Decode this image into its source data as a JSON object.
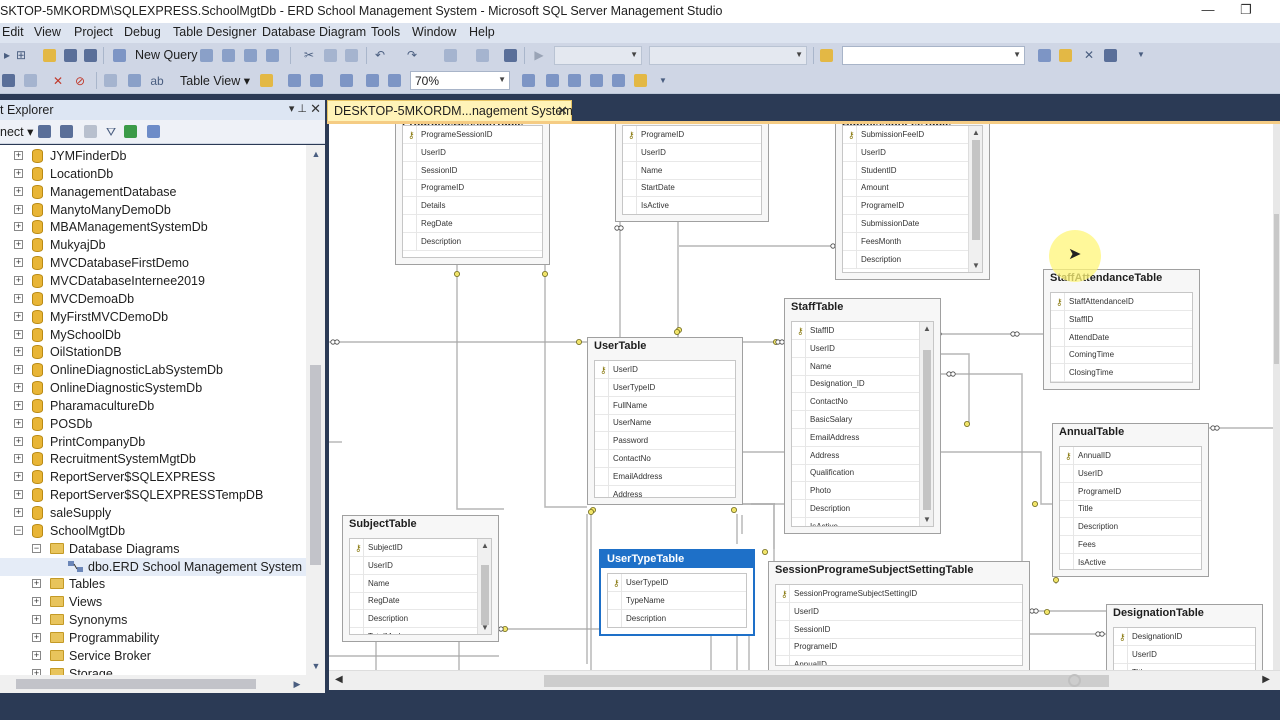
{
  "window": {
    "title": "SKTOP-5MKORDM\\SQLEXPRESS.SchoolMgtDb - ERD School Management System - Microsoft SQL Server Management Studio",
    "minimize": "—",
    "restore": "❐"
  },
  "menu": [
    "Edit",
    "View",
    "Project",
    "Debug",
    "Table Designer",
    "Database Diagram",
    "Tools",
    "Window",
    "Help"
  ],
  "toolbar": {
    "new_query": "New Query",
    "table_view": "Table View",
    "zoom": "70%"
  },
  "explorer": {
    "title": "t Explorer",
    "connect": "nect",
    "nodes": [
      {
        "label": "JYMFinderDb",
        "level": 1,
        "icon": "db",
        "expander": "+"
      },
      {
        "label": "LocationDb",
        "level": 1,
        "icon": "db",
        "expander": "+"
      },
      {
        "label": "ManagementDatabase",
        "level": 1,
        "icon": "db",
        "expander": "+"
      },
      {
        "label": "ManytoManyDemoDb",
        "level": 1,
        "icon": "db",
        "expander": "+"
      },
      {
        "label": "MBAManagementSystemDb",
        "level": 1,
        "icon": "db",
        "expander": "+"
      },
      {
        "label": "MukyajDb",
        "level": 1,
        "icon": "db",
        "expander": "+"
      },
      {
        "label": "MVCDatabaseFirstDemo",
        "level": 1,
        "icon": "db",
        "expander": "+"
      },
      {
        "label": "MVCDatabaseInternee2019",
        "level": 1,
        "icon": "db",
        "expander": "+"
      },
      {
        "label": "MVCDemoaDb",
        "level": 1,
        "icon": "db",
        "expander": "+"
      },
      {
        "label": "MyFirstMVCDemoDb",
        "level": 1,
        "icon": "db",
        "expander": "+"
      },
      {
        "label": "MySchoolDb",
        "level": 1,
        "icon": "db",
        "expander": "+"
      },
      {
        "label": "OilStationDB",
        "level": 1,
        "icon": "db",
        "expander": "+"
      },
      {
        "label": "OnlineDiagnosticLabSystemDb",
        "level": 1,
        "icon": "db",
        "expander": "+"
      },
      {
        "label": "OnlineDiagnosticSystemDb",
        "level": 1,
        "icon": "db",
        "expander": "+"
      },
      {
        "label": "PharamacultureDb",
        "level": 1,
        "icon": "db",
        "expander": "+"
      },
      {
        "label": "POSDb",
        "level": 1,
        "icon": "db",
        "expander": "+"
      },
      {
        "label": "PrintCompanyDb",
        "level": 1,
        "icon": "db",
        "expander": "+"
      },
      {
        "label": "RecruitmentSystemMgtDb",
        "level": 1,
        "icon": "db",
        "expander": "+"
      },
      {
        "label": "ReportServer$SQLEXPRESS",
        "level": 1,
        "icon": "db",
        "expander": "+"
      },
      {
        "label": "ReportServer$SQLEXPRESSTempDB",
        "level": 1,
        "icon": "db",
        "expander": "+"
      },
      {
        "label": "saleSupply",
        "level": 1,
        "icon": "db",
        "expander": "+"
      },
      {
        "label": "SchoolMgtDb",
        "level": 1,
        "icon": "db",
        "expander": "−"
      },
      {
        "label": "Database Diagrams",
        "level": 2,
        "icon": "folder",
        "expander": "−"
      },
      {
        "label": "dbo.ERD School Management System",
        "level": 3,
        "icon": "diagram",
        "expander": ""
      },
      {
        "label": "Tables",
        "level": 2,
        "icon": "folder",
        "expander": "+"
      },
      {
        "label": "Views",
        "level": 2,
        "icon": "folder",
        "expander": "+"
      },
      {
        "label": "Synonyms",
        "level": 2,
        "icon": "folder",
        "expander": "+"
      },
      {
        "label": "Programmability",
        "level": 2,
        "icon": "folder",
        "expander": "+"
      },
      {
        "label": "Service Broker",
        "level": 2,
        "icon": "folder",
        "expander": "+"
      },
      {
        "label": "Storage",
        "level": 2,
        "icon": "folder",
        "expander": "+"
      }
    ]
  },
  "document_tab": {
    "label": "DESKTOP-5MKORDM...nagement System",
    "close": "✕"
  },
  "diagram": {
    "tables": [
      {
        "name": "ProgrameSessionTable",
        "columns": [
          "ProgrameSessionID",
          "UserID",
          "SessionID",
          "ProgrameID",
          "Details",
          "RegDate",
          "Description"
        ],
        "keys": [
          0
        ]
      },
      {
        "name": "",
        "columns": [
          "ProgrameID",
          "UserID",
          "Name",
          "StartDate",
          "IsActive"
        ],
        "keys": [
          0
        ]
      },
      {
        "name": "SubmissionFeeTable",
        "columns": [
          "SubmissionFeeID",
          "UserID",
          "StudentID",
          "Amount",
          "ProgrameID",
          "SubmissionDate",
          "FeesMonth",
          "Description"
        ],
        "keys": [
          0
        ],
        "scroll": true
      },
      {
        "name": "StaffAttendanceTable",
        "columns": [
          "StaffAttendanceID",
          "StaffID",
          "AttendDate",
          "ComingTime",
          "ClosingTime"
        ],
        "keys": [
          0
        ]
      },
      {
        "name": "StaffTable",
        "columns": [
          "StaffID",
          "UserID",
          "Name",
          "Designation_ID",
          "ContactNo",
          "BasicSalary",
          "EmailAddress",
          "Address",
          "Qualification",
          "Photo",
          "Description",
          "IsActive"
        ],
        "keys": [
          0
        ],
        "scroll": true
      },
      {
        "name": "UserTable",
        "columns": [
          "UserID",
          "UserTypeID",
          "FullName",
          "UserName",
          "Password",
          "ContactNo",
          "EmailAddress",
          "Address"
        ],
        "keys": [
          0
        ]
      },
      {
        "name": "AnnualTable",
        "columns": [
          "AnnualID",
          "UserID",
          "ProgrameID",
          "Title",
          "Description",
          "Fees",
          "IsActive"
        ],
        "keys": [
          0
        ]
      },
      {
        "name": "SubjectTable",
        "columns": [
          "SubjectID",
          "UserID",
          "Name",
          "RegDate",
          "Description",
          "TotalMarks"
        ],
        "keys": [
          0
        ],
        "scroll": true
      },
      {
        "name": "UserTypeTable",
        "columns": [
          "UserTypeID",
          "TypeName",
          "Description"
        ],
        "keys": [
          0
        ],
        "selected": true
      },
      {
        "name": "SessionProgrameSubjectSettingTable",
        "columns": [
          "SessionProgrameSubjectSettingID",
          "UserID",
          "SessionID",
          "ProgrameID",
          "AnnualID"
        ],
        "keys": [
          0
        ]
      },
      {
        "name": "DesignationTable",
        "columns": [
          "DesignationID",
          "UserID",
          "Title"
        ],
        "keys": [
          0
        ]
      }
    ]
  },
  "colors": {
    "background": "#2b3a55",
    "menubar": "#dde4f0",
    "toolbar": "#cfd6e5",
    "tab_active": "#fff3b8",
    "selected_table": "#1e70c8",
    "relationship_line": "#8a8a8a",
    "key_icon": "#8a7a10"
  }
}
